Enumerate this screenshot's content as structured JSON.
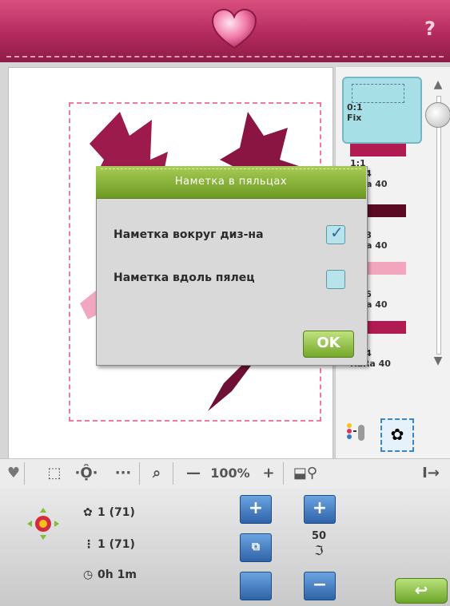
{
  "topbar": {
    "help_label": "?"
  },
  "dialog": {
    "title": "Наметка в пяльцах",
    "option1_label": "Наметка вокруг диз-на",
    "option1_checked": true,
    "option2_label": "Наметка вдоль пялец",
    "option2_checked": false,
    "ok_label": "OK"
  },
  "threads": {
    "block0_line1": "0:1",
    "block0_line2": "Fix",
    "items": [
      {
        "label": "1:1\n   04\n   Ra 40",
        "color": "#b01c52"
      },
      {
        "label": "   08\n   Ra 40",
        "color": "#5a0a22"
      },
      {
        "label": "   76\n   Ra 40",
        "color": "#f1a6bd"
      },
      {
        "label": "   04\nRaRa 40",
        "color": "#b01c52"
      }
    ]
  },
  "toolbar": {
    "heart": "♥",
    "zoom_minus": "—",
    "zoom_value": "100%",
    "zoom_plus": "+",
    "dots": "···",
    "arrow": "I→"
  },
  "bottom": {
    "info1": "1 (71)",
    "info2": "1 (71)",
    "time": "0h 1m",
    "speed_value": "50"
  },
  "colors": {
    "accent": "#b42a5e",
    "dialog_title": "#8bb53a",
    "button_blue": "#2f63a9"
  }
}
